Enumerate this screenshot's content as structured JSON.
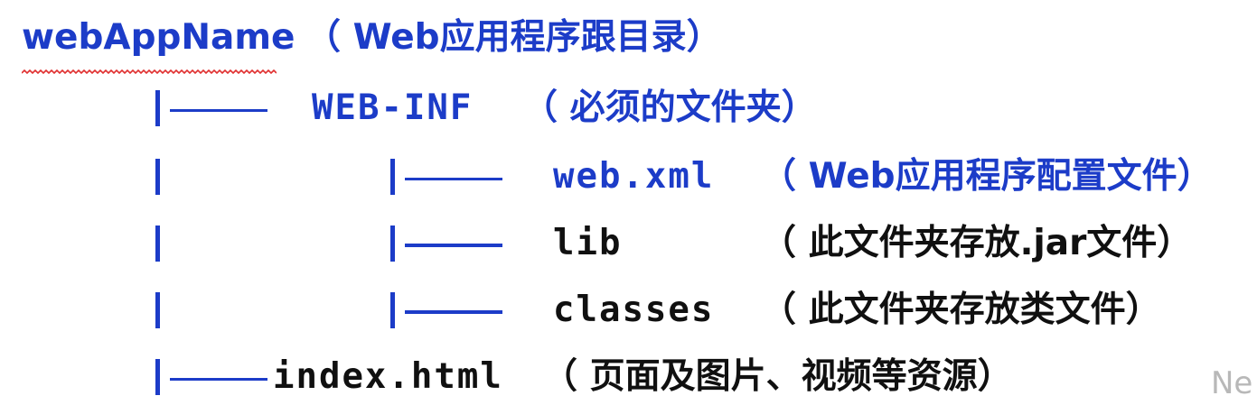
{
  "root": {
    "name": "webAppName",
    "desc": "（ Web应用程序跟目录）"
  },
  "web_inf": {
    "name": "WEB-INF",
    "desc": "（ 必须的文件夹）"
  },
  "web_xml": {
    "name": "web.xml",
    "desc": "（ Web应用程序配置文件）"
  },
  "lib": {
    "name": "lib",
    "desc": "（ 此文件夹存放.jar文件）"
  },
  "classes": {
    "name": "classes",
    "desc": "（ 此文件夹存放类文件）"
  },
  "index": {
    "name": "index.html",
    "desc": "（ 页面及图片、视频等资源）"
  },
  "watermark": "Ne",
  "colors": {
    "accent": "#1c3cc8",
    "text": "#101010",
    "spellcheck": "#e03030"
  }
}
